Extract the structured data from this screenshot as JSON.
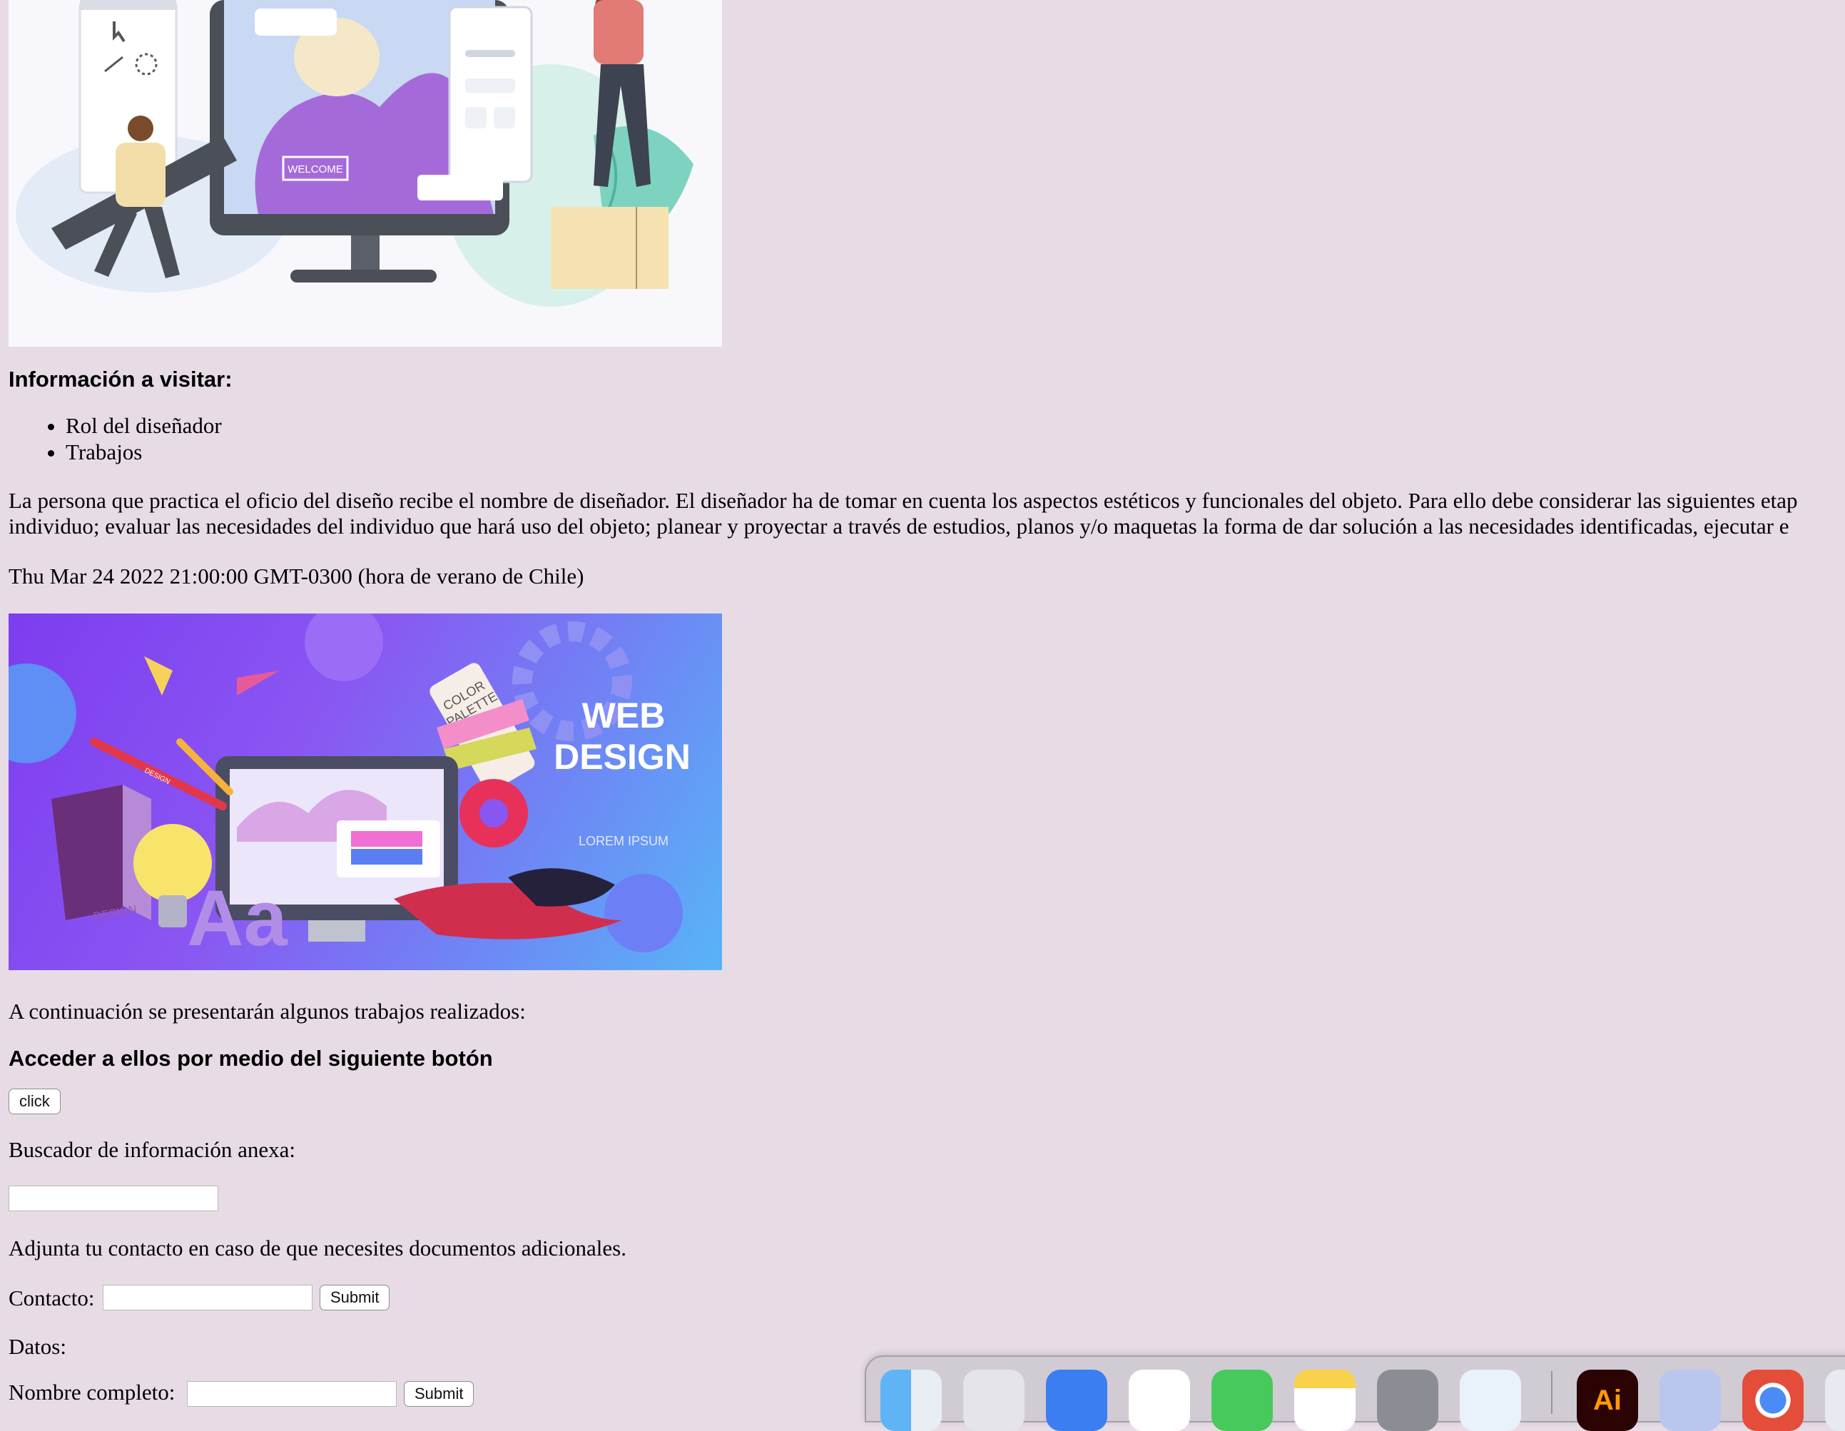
{
  "section1": {
    "heading": "Información a visitar:",
    "bullets": [
      "Rol del diseñador",
      "Trabajos"
    ],
    "paragraph_line1": "La persona que practica el oficio del diseño recibe el nombre de diseñador. El diseñador ha de tomar en cuenta los aspectos estéticos y funcionales del objeto. Para ello debe considerar las siguientes etap",
    "paragraph_line2": "individuo; evaluar las necesidades del individuo que hará uso del objeto; planear y proyectar a través de estudios, planos y/o maquetas la forma de dar solución a las necesidades identificadas, ejecutar e",
    "date": "Thu Mar 24 2022 21:00:00 GMT-0300 (hora de verano de Chile)"
  },
  "hero1": {
    "tag": "WELCOME"
  },
  "hero2": {
    "title_line1": "WEB",
    "title_line2": "DESIGN",
    "subtitle": "LOREM IPSUM",
    "palette_line1": "COLOR",
    "palette_line2": "PALETTE",
    "book_label": "DESIGN",
    "pencil_label": "DESIGN",
    "letters": "Aa"
  },
  "section2": {
    "intro": "A continuación se presentarán algunos trabajos realizados:",
    "heading": "Acceder a ellos por medio del siguiente botón",
    "click_label": "click",
    "search_label": "Buscador de información anexa:",
    "contact_intro": "Adjunta tu contacto en caso de que necesites documentos adicionales.",
    "contact_label": "Contacto:",
    "contact_submit": "Submit",
    "datos_label": "Datos:",
    "name_label": "Nombre completo:",
    "name_submit": "Submit"
  },
  "dock": {
    "items": [
      "finder-icon",
      "launchpad-icon",
      "mail-icon",
      "photos-icon",
      "facetime-icon",
      "notes-icon",
      "system-settings-icon",
      "safari-icon",
      "illustrator-icon",
      "preview-icon",
      "chrome-icon",
      "more-icon"
    ],
    "illustrator_label": "Ai"
  }
}
